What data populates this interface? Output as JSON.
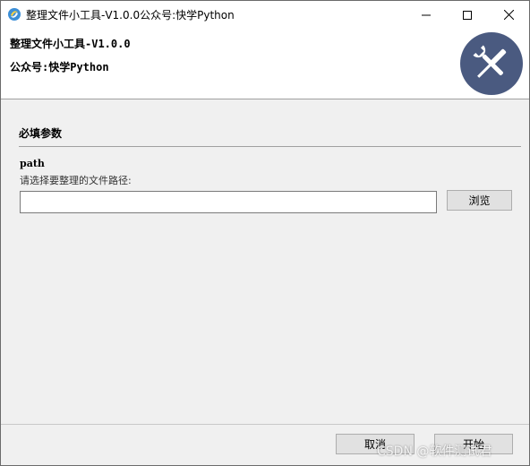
{
  "window": {
    "title": "整理文件小工具-V1.0.0公众号:快学Python",
    "icon": "app-logo-icon",
    "controls": {
      "minimize": "minimize-icon",
      "maximize": "maximize-icon",
      "close": "close-icon"
    }
  },
  "header": {
    "title": "整理文件小工具-V1.0.0",
    "subtitle": "公众号:快学Python",
    "logo_icon": "tools-icon",
    "logo_color": "#4a5a80"
  },
  "main": {
    "section_title": "必填参数",
    "field": {
      "name": "path",
      "help": "请选择要整理的文件路径:",
      "value": "",
      "browse_label": "浏览"
    }
  },
  "footer": {
    "cancel_label": "取消",
    "start_label": "开始"
  },
  "watermark": "CSDN @软件测试君"
}
